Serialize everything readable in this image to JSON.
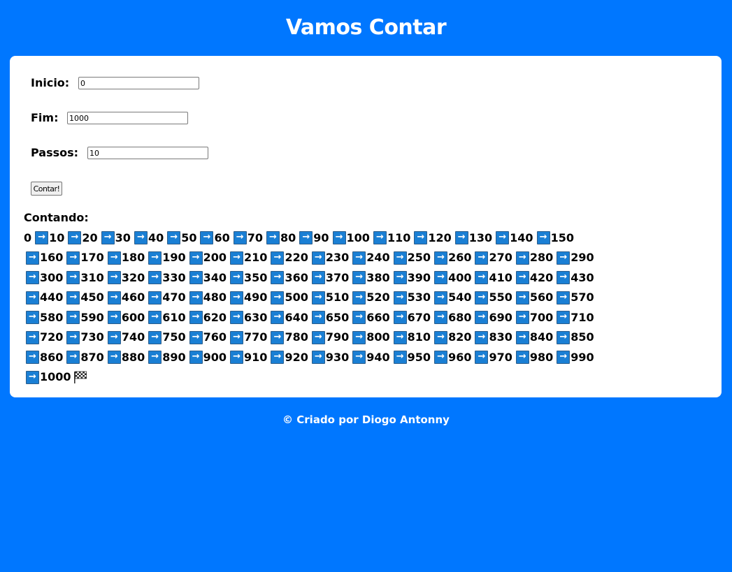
{
  "page": {
    "title": "Vamos Contar"
  },
  "form": {
    "inicio": {
      "label": "Inicio:",
      "value": "0"
    },
    "fim": {
      "label": "Fim:",
      "value": "1000"
    },
    "passos": {
      "label": "Passos:",
      "value": "10"
    },
    "button_label": "Contar!"
  },
  "result": {
    "title": "Contando:",
    "start": 0,
    "end": 1000,
    "step": 10,
    "line_breaks_before": [
      160,
      300,
      440,
      580,
      720,
      860,
      1000
    ],
    "arrow_icon": "right-arrow-icon",
    "finish_icon": "checkered-flag-icon"
  },
  "footer": {
    "text": "© Criado por Diogo Antonny"
  },
  "colors": {
    "background": "#0077ff",
    "card": "#ffffff",
    "arrow_box": "#1a7fd4"
  }
}
